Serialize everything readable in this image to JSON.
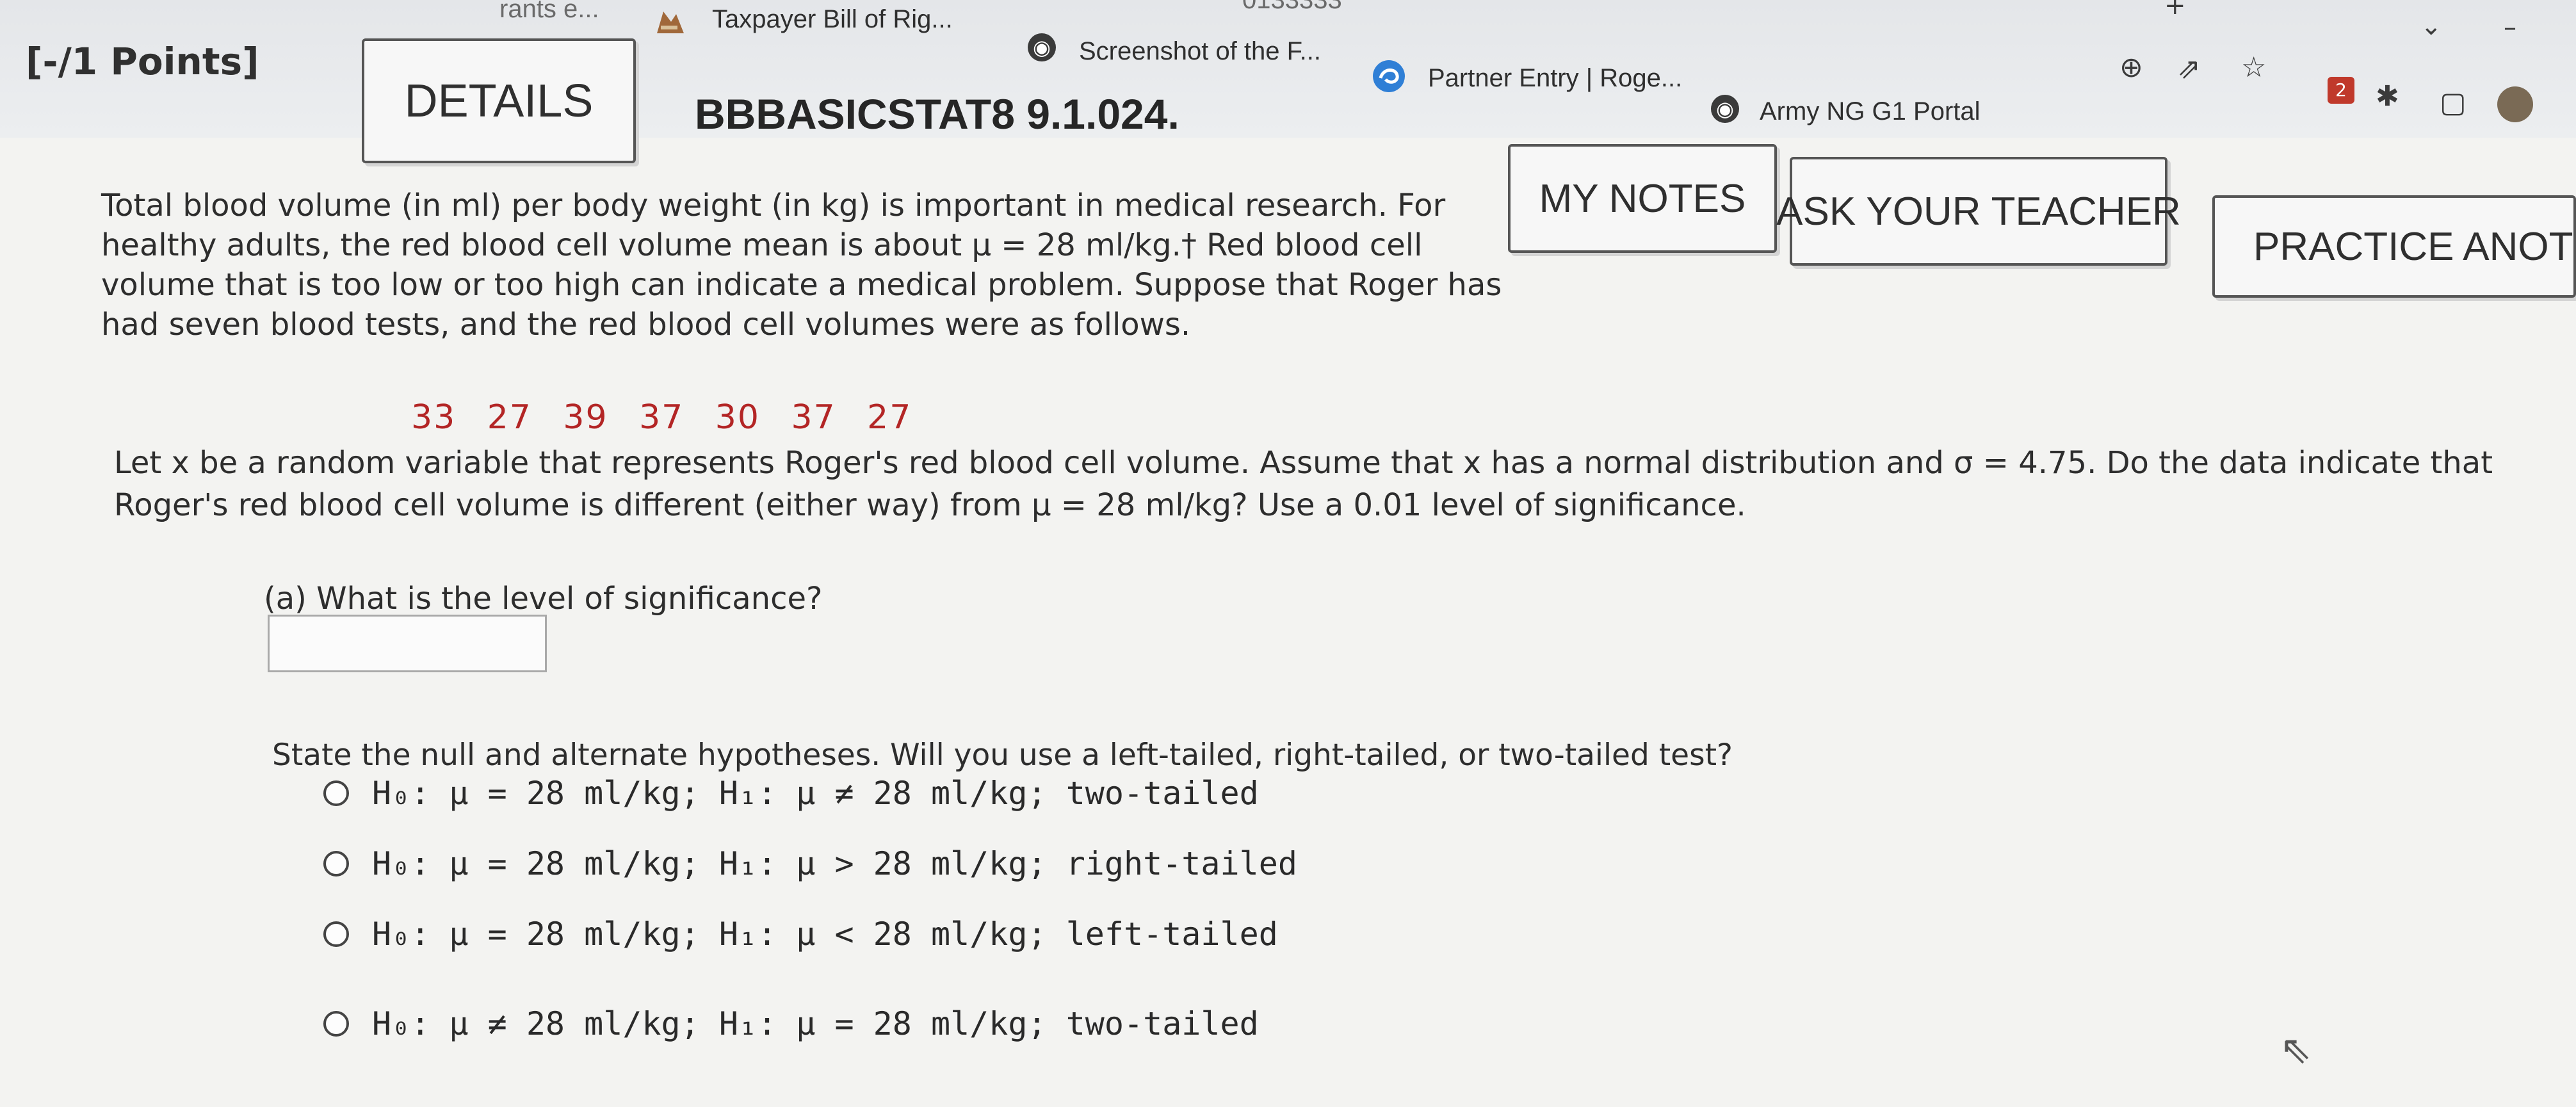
{
  "browser": {
    "bookmarks": [
      {
        "label": "Taxpayer Bill of Rig...",
        "icon": "document-icon"
      },
      {
        "label": "Screenshot of the F...",
        "icon": "globe-icon"
      },
      {
        "label": "Partner Entry | Roge...",
        "icon": "swirl-icon"
      },
      {
        "label": "Army NG G1 Portal",
        "icon": "globe-icon"
      }
    ],
    "partial_bookmark": "rants e...",
    "partial_tab_text": "0133333",
    "extension_badge": "2"
  },
  "header": {
    "points": "[-/1 Points]",
    "details_label": "DETAILS",
    "question_id": "BBBASICSTAT8 9.1.024.",
    "my_notes_label": "MY NOTES",
    "ask_teacher_label": "ASK YOUR TEACHER",
    "practice_label": "PRACTICE ANOTHER"
  },
  "problem": {
    "intro": "Total blood volume (in ml) per body weight (in kg) is important in medical research. For healthy adults, the red blood cell volume mean is about μ = 28 ml/kg.† Red blood cell volume that is too low or too high can indicate a medical problem. Suppose that Roger has had seven blood tests, and the red blood cell volumes were as follows.",
    "data_values": "33   27   39   37   30   37   27",
    "setup": "Let x be a random variable that represents Roger's red blood cell volume. Assume that x has a normal distribution and σ = 4.75. Do the data indicate that Roger's red blood cell volume is different (either way) from μ = 28 ml/kg? Use a 0.01 level of significance.",
    "part_a": "(a) What is the level of significance?",
    "answer_value": "",
    "hypotheses_prompt": "State the null and alternate hypotheses. Will you use a left-tailed, right-tailed, or two-tailed test?",
    "options": [
      "H₀: μ = 28 ml/kg; H₁: μ ≠ 28 ml/kg; two-tailed",
      "H₀: μ = 28 ml/kg; H₁: μ > 28 ml/kg; right-tailed",
      "H₀: μ = 28 ml/kg; H₁: μ < 28 ml/kg; left-tailed",
      "H₀: μ ≠ 28 ml/kg; H₁: μ = 28 ml/kg; two-tailed"
    ]
  },
  "colors": {
    "data_values": "#b32525",
    "button_border": "#555555",
    "page_background": "#f3f3f1"
  }
}
